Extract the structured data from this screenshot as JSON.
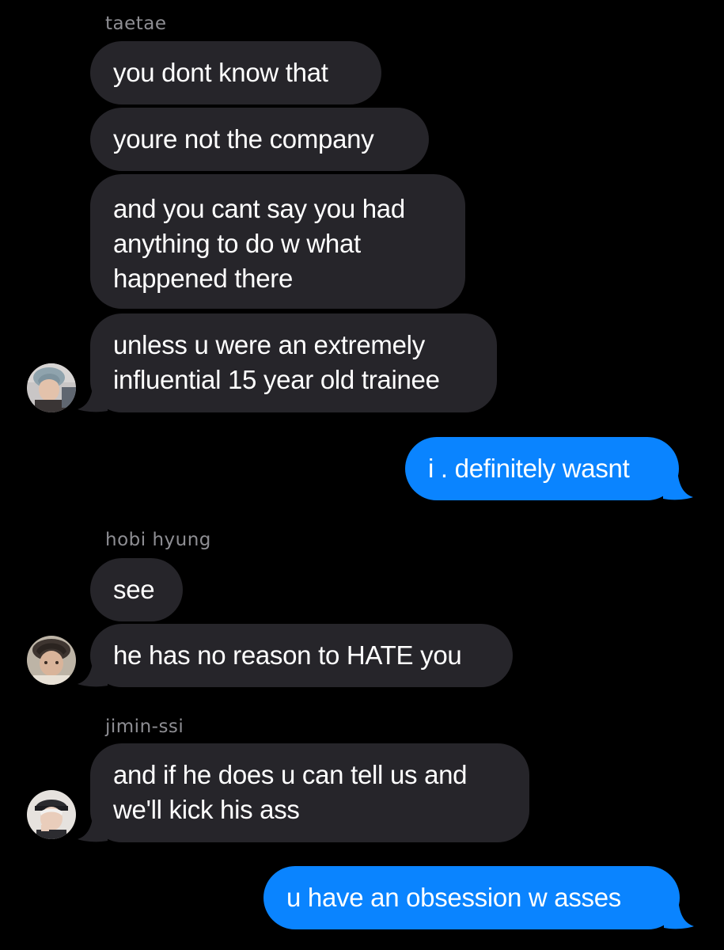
{
  "colors": {
    "background": "#000000",
    "incoming_bubble": "#26252a",
    "outgoing_bubble": "#0a84ff",
    "sender_name": "#8e8e93",
    "text": "#ffffff"
  },
  "groups": [
    {
      "sender": "taetae",
      "avatar_icon": "contact-avatar-taetae",
      "messages": [
        {
          "lines": [
            "you dont know that"
          ]
        },
        {
          "lines": [
            "youre not the company"
          ]
        },
        {
          "lines": [
            "and you cant say you had",
            "anything to do w what",
            "happened there"
          ]
        },
        {
          "lines": [
            "unless u were an extremely",
            "influential 15 year old trainee"
          ]
        }
      ]
    },
    {
      "outgoing": true,
      "messages": [
        {
          "lines": [
            "i . definitely wasnt"
          ]
        }
      ]
    },
    {
      "sender": "hobi hyung",
      "avatar_icon": "contact-avatar-hobi",
      "messages": [
        {
          "lines": [
            "see"
          ]
        },
        {
          "lines": [
            "he has no reason to HATE you"
          ]
        }
      ]
    },
    {
      "sender": "jimin-ssi",
      "avatar_icon": "contact-avatar-jimin",
      "messages": [
        {
          "lines": [
            "and if he does u can tell us and",
            "we'll kick his ass"
          ]
        }
      ]
    },
    {
      "outgoing": true,
      "messages": [
        {
          "lines": [
            "u have an obsession w asses"
          ]
        }
      ]
    }
  ]
}
